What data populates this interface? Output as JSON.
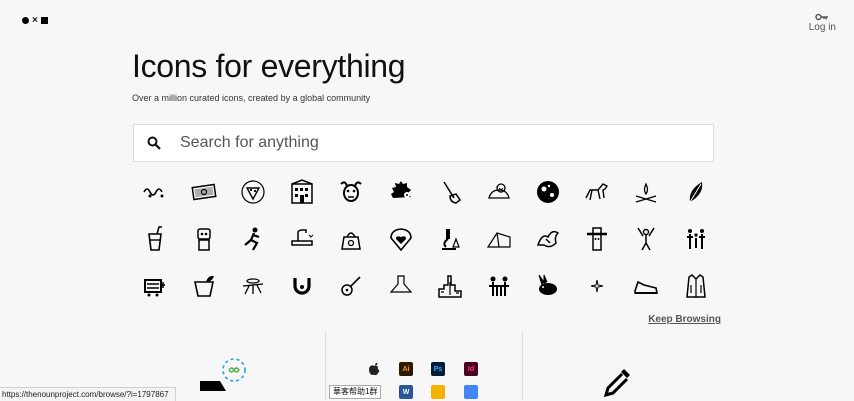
{
  "header": {
    "login_label": "Log in",
    "logo_icon": "noun-project-logo-icon",
    "login_icon": "key-icon"
  },
  "hero": {
    "title": "Icons for everything",
    "subtitle": "Over a million curated icons, created by a global community"
  },
  "search": {
    "placeholder": "Search for anything",
    "value": ""
  },
  "icons": [
    [
      "squiggle-icon",
      "money-cash-icon",
      "pizza-badge-icon",
      "building-icon",
      "goat-face-icon",
      "hedgehog-icon",
      "hand-wand-icon",
      "hand-snail-icon",
      "moon-face-icon",
      "horse-icon",
      "campfire-icon",
      "feather-leaf-icon"
    ],
    [
      "cup-straw-icon",
      "robot-icon",
      "climber-icon",
      "sink-faucet-icon",
      "kettle-icon",
      "heart-shield-icon",
      "microscope-icon",
      "tent-icon",
      "dragon-icon",
      "totem-icon",
      "cheerleader-icon",
      "family-icon"
    ],
    [
      "truck-cart-icon",
      "bowl-plant-icon",
      "mosquito-icon",
      "horseshoe-icon",
      "guitar-icon",
      "range-hood-icon",
      "city-skyline-icon",
      "people-table-icon",
      "rabbit-icon",
      "sparkle-icon",
      "sneaker-icon",
      "jacket-icon"
    ]
  ],
  "keep_browsing": "Keep Browsing",
  "status_url": "https://thenounproject.com/browse/?i=1797867",
  "ime_chip": "華客帮助1群",
  "app_icons": [
    "apple-icon",
    "illustrator-icon",
    "photoshop-icon",
    "indesign-icon",
    "word-icon",
    "slides-icon",
    "docs-icon"
  ],
  "app_labels": {
    "ai": "Ai",
    "ps": "Ps",
    "id": "Id",
    "word": "W"
  },
  "colors": {
    "accent": "#000000",
    "illustrator": "#ff9a00",
    "photoshop": "#31a8ff",
    "indesign": "#ff3366",
    "word": "#2b579a",
    "slides": "#f4b400",
    "docs": "#4285f4",
    "sync": "#1ea7d6"
  }
}
